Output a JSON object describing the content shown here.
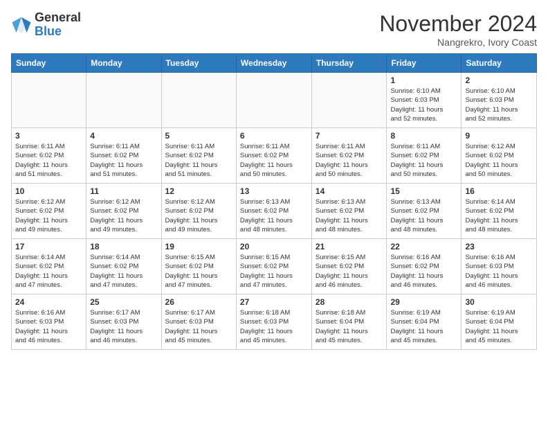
{
  "header": {
    "logo_line1": "General",
    "logo_line2": "Blue",
    "month_year": "November 2024",
    "location": "Nangrekro, Ivory Coast"
  },
  "weekdays": [
    "Sunday",
    "Monday",
    "Tuesday",
    "Wednesday",
    "Thursday",
    "Friday",
    "Saturday"
  ],
  "weeks": [
    [
      {
        "day": "",
        "detail": ""
      },
      {
        "day": "",
        "detail": ""
      },
      {
        "day": "",
        "detail": ""
      },
      {
        "day": "",
        "detail": ""
      },
      {
        "day": "",
        "detail": ""
      },
      {
        "day": "1",
        "detail": "Sunrise: 6:10 AM\nSunset: 6:03 PM\nDaylight: 11 hours\nand 52 minutes."
      },
      {
        "day": "2",
        "detail": "Sunrise: 6:10 AM\nSunset: 6:03 PM\nDaylight: 11 hours\nand 52 minutes."
      }
    ],
    [
      {
        "day": "3",
        "detail": "Sunrise: 6:11 AM\nSunset: 6:02 PM\nDaylight: 11 hours\nand 51 minutes."
      },
      {
        "day": "4",
        "detail": "Sunrise: 6:11 AM\nSunset: 6:02 PM\nDaylight: 11 hours\nand 51 minutes."
      },
      {
        "day": "5",
        "detail": "Sunrise: 6:11 AM\nSunset: 6:02 PM\nDaylight: 11 hours\nand 51 minutes."
      },
      {
        "day": "6",
        "detail": "Sunrise: 6:11 AM\nSunset: 6:02 PM\nDaylight: 11 hours\nand 50 minutes."
      },
      {
        "day": "7",
        "detail": "Sunrise: 6:11 AM\nSunset: 6:02 PM\nDaylight: 11 hours\nand 50 minutes."
      },
      {
        "day": "8",
        "detail": "Sunrise: 6:11 AM\nSunset: 6:02 PM\nDaylight: 11 hours\nand 50 minutes."
      },
      {
        "day": "9",
        "detail": "Sunrise: 6:12 AM\nSunset: 6:02 PM\nDaylight: 11 hours\nand 50 minutes."
      }
    ],
    [
      {
        "day": "10",
        "detail": "Sunrise: 6:12 AM\nSunset: 6:02 PM\nDaylight: 11 hours\nand 49 minutes."
      },
      {
        "day": "11",
        "detail": "Sunrise: 6:12 AM\nSunset: 6:02 PM\nDaylight: 11 hours\nand 49 minutes."
      },
      {
        "day": "12",
        "detail": "Sunrise: 6:12 AM\nSunset: 6:02 PM\nDaylight: 11 hours\nand 49 minutes."
      },
      {
        "day": "13",
        "detail": "Sunrise: 6:13 AM\nSunset: 6:02 PM\nDaylight: 11 hours\nand 48 minutes."
      },
      {
        "day": "14",
        "detail": "Sunrise: 6:13 AM\nSunset: 6:02 PM\nDaylight: 11 hours\nand 48 minutes."
      },
      {
        "day": "15",
        "detail": "Sunrise: 6:13 AM\nSunset: 6:02 PM\nDaylight: 11 hours\nand 48 minutes."
      },
      {
        "day": "16",
        "detail": "Sunrise: 6:14 AM\nSunset: 6:02 PM\nDaylight: 11 hours\nand 48 minutes."
      }
    ],
    [
      {
        "day": "17",
        "detail": "Sunrise: 6:14 AM\nSunset: 6:02 PM\nDaylight: 11 hours\nand 47 minutes."
      },
      {
        "day": "18",
        "detail": "Sunrise: 6:14 AM\nSunset: 6:02 PM\nDaylight: 11 hours\nand 47 minutes."
      },
      {
        "day": "19",
        "detail": "Sunrise: 6:15 AM\nSunset: 6:02 PM\nDaylight: 11 hours\nand 47 minutes."
      },
      {
        "day": "20",
        "detail": "Sunrise: 6:15 AM\nSunset: 6:02 PM\nDaylight: 11 hours\nand 47 minutes."
      },
      {
        "day": "21",
        "detail": "Sunrise: 6:15 AM\nSunset: 6:02 PM\nDaylight: 11 hours\nand 46 minutes."
      },
      {
        "day": "22",
        "detail": "Sunrise: 6:16 AM\nSunset: 6:02 PM\nDaylight: 11 hours\nand 46 minutes."
      },
      {
        "day": "23",
        "detail": "Sunrise: 6:16 AM\nSunset: 6:03 PM\nDaylight: 11 hours\nand 46 minutes."
      }
    ],
    [
      {
        "day": "24",
        "detail": "Sunrise: 6:16 AM\nSunset: 6:03 PM\nDaylight: 11 hours\nand 46 minutes."
      },
      {
        "day": "25",
        "detail": "Sunrise: 6:17 AM\nSunset: 6:03 PM\nDaylight: 11 hours\nand 46 minutes."
      },
      {
        "day": "26",
        "detail": "Sunrise: 6:17 AM\nSunset: 6:03 PM\nDaylight: 11 hours\nand 45 minutes."
      },
      {
        "day": "27",
        "detail": "Sunrise: 6:18 AM\nSunset: 6:03 PM\nDaylight: 11 hours\nand 45 minutes."
      },
      {
        "day": "28",
        "detail": "Sunrise: 6:18 AM\nSunset: 6:04 PM\nDaylight: 11 hours\nand 45 minutes."
      },
      {
        "day": "29",
        "detail": "Sunrise: 6:19 AM\nSunset: 6:04 PM\nDaylight: 11 hours\nand 45 minutes."
      },
      {
        "day": "30",
        "detail": "Sunrise: 6:19 AM\nSunset: 6:04 PM\nDaylight: 11 hours\nand 45 minutes."
      }
    ]
  ]
}
